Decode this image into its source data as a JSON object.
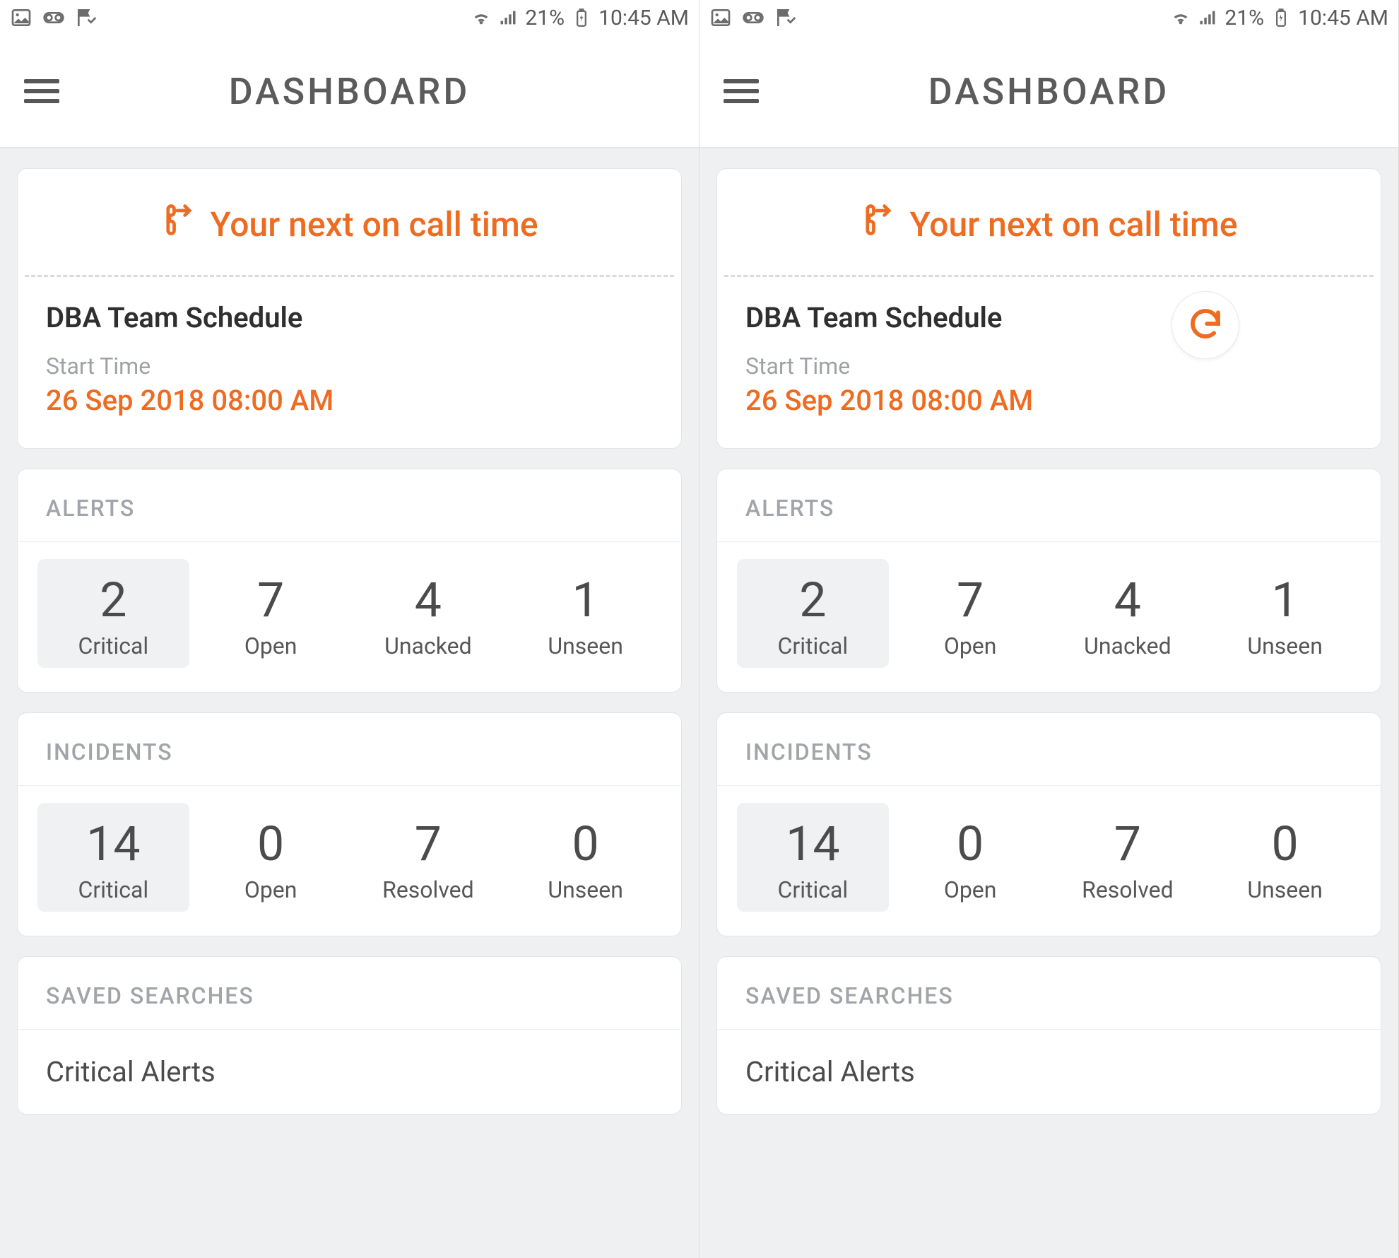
{
  "status": {
    "battery_pct": "21%",
    "time": "10:45 AM"
  },
  "app_title": "DASHBOARD",
  "oncall": {
    "heading": "Your next on call time",
    "schedule_name": "DBA Team Schedule",
    "start_label": "Start Time",
    "start_value": "26 Sep 2018 08:00 AM"
  },
  "alerts": {
    "title": "ALERTS",
    "items": [
      {
        "value": "2",
        "label": "Critical"
      },
      {
        "value": "7",
        "label": "Open"
      },
      {
        "value": "4",
        "label": "Unacked"
      },
      {
        "value": "1",
        "label": "Unseen"
      }
    ]
  },
  "incidents": {
    "title": "INCIDENTS",
    "items": [
      {
        "value": "14",
        "label": "Critical"
      },
      {
        "value": "0",
        "label": "Open"
      },
      {
        "value": "7",
        "label": "Resolved"
      },
      {
        "value": "0",
        "label": "Unseen"
      }
    ]
  },
  "saved": {
    "title": "SAVED SEARCHES",
    "items": [
      "Critical Alerts"
    ]
  },
  "screens": [
    {
      "show_refresh": false
    },
    {
      "show_refresh": true
    }
  ]
}
